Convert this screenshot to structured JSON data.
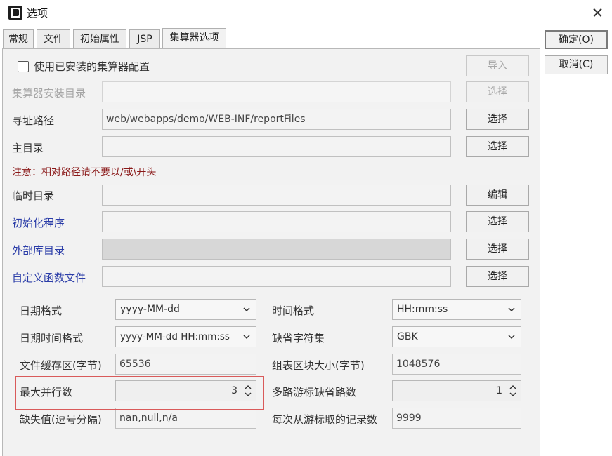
{
  "window": {
    "title": "选项",
    "icon": "app-logo-icon"
  },
  "tabs": [
    {
      "label": "常规",
      "active": false
    },
    {
      "label": "文件",
      "active": false
    },
    {
      "label": "初始属性",
      "active": false
    },
    {
      "label": "JSP",
      "active": false
    },
    {
      "label": "集算器选项",
      "active": true
    }
  ],
  "side_buttons": {
    "ok": "确定(O)",
    "cancel": "取消(C)"
  },
  "use_installed": {
    "label": "使用已安装的集算器配置",
    "checked": false,
    "import_label": "导入"
  },
  "rows": {
    "install_dir": {
      "label": "集算器安装目录",
      "value": "",
      "button": "选择"
    },
    "search_path": {
      "label": "寻址路径",
      "value": "web/webapps/demo/WEB-INF/reportFiles",
      "button": "选择"
    },
    "main_dir": {
      "label": "主目录",
      "value": "",
      "button": "选择"
    },
    "notice": "注意：相对路径请不要以/或\\开头",
    "temp_dir": {
      "label": "临时目录",
      "value": "",
      "button": "编辑"
    },
    "init_program": {
      "label": "初始化程序",
      "value": "",
      "button": "选择"
    },
    "ext_lib_dir": {
      "label": "外部库目录",
      "value": "",
      "button": "选择"
    },
    "custom_func_file": {
      "label": "自定义函数文件",
      "value": "",
      "button": "选择"
    }
  },
  "params": {
    "date_format": {
      "label": "日期格式",
      "value": "yyyy-MM-dd"
    },
    "time_format": {
      "label": "时间格式",
      "value": "HH:mm:ss"
    },
    "datetime_format": {
      "label": "日期时间格式",
      "value": "yyyy-MM-dd HH:mm:ss"
    },
    "default_charset": {
      "label": "缺省字符集",
      "value": "GBK"
    },
    "file_buffer": {
      "label": "文件缓存区(字节)",
      "value": "65536"
    },
    "block_size": {
      "label": "组表区块大小(字节)",
      "value": "1048576"
    },
    "max_parallel": {
      "label": "最大并行数",
      "value": "3"
    },
    "cursor_paths": {
      "label": "多路游标缺省路数",
      "value": "1"
    },
    "null_values": {
      "label": "缺失值(逗号分隔)",
      "value": "nan,null,n/a"
    },
    "fetch_count": {
      "label": "每次从游标取的记录数",
      "value": "9999"
    }
  },
  "colors": {
    "link": "#2b3da8",
    "warning": "#8a1818",
    "highlight": "#d95a5a"
  }
}
